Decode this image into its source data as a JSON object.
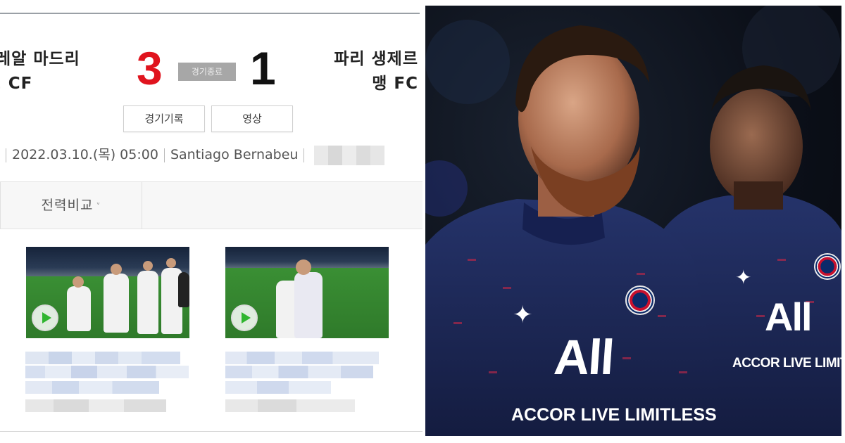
{
  "scoreboard": {
    "home_team_line1": "레알 마드리",
    "home_team_line2": "E CF",
    "away_team_line1": "파리 생제르",
    "away_team_line2": "맹 FC",
    "home_score": "3",
    "away_score": "1",
    "status": "경기종료",
    "score_colors": {
      "home": "#e0141e",
      "away": "#111111"
    }
  },
  "actions": {
    "record_label": "경기기록",
    "video_label": "영상"
  },
  "match_info": {
    "datetime": "2022.03.10.(목) 05:00",
    "venue": "Santiago Bernabeu"
  },
  "tabs": {
    "compare_label": "전력비교",
    "compare_caret": "˅"
  },
  "videos": [
    {
      "thumbnail": "celebration-pitch",
      "play_icon": "play-icon"
    },
    {
      "thumbnail": "hug-pitch",
      "play_icon": "play-icon"
    }
  ],
  "photo": {
    "sponsor_logo": "All",
    "sponsor_text": "ACCOR LIVE LIMITLESS",
    "sponsor_text_2": "ACCOR LIVE LIMIT",
    "jersey_color": "#1d2a5c"
  }
}
